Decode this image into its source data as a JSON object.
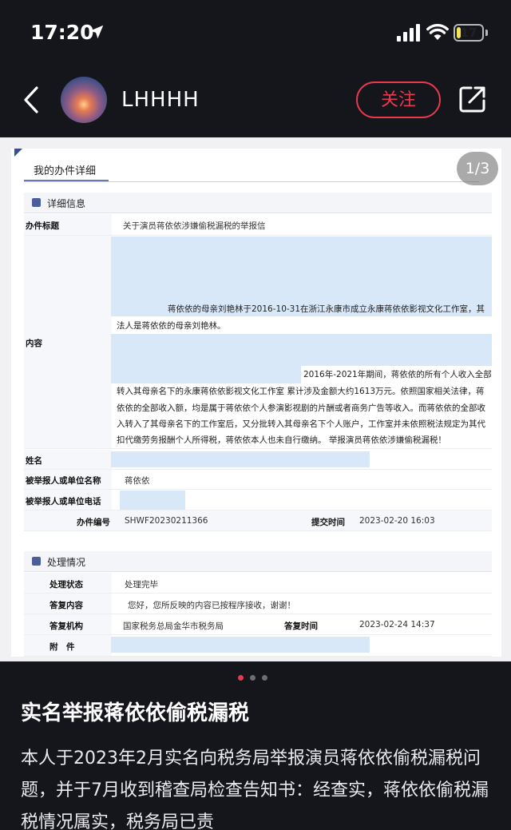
{
  "status_bar": {
    "time": "17:20",
    "battery": "17",
    "battery_level": 0.17
  },
  "nav": {
    "username": "LHHHH",
    "follow_label": "关注"
  },
  "pager": "1/3",
  "doc": {
    "title": "我的办件详细",
    "detail_section": "详细信息",
    "labels": {
      "subject": "办件标题",
      "content": "内容",
      "name": "姓名",
      "reported": "被举报人或单位名称",
      "reported_phone": "被举报人或单位电话",
      "number": "办件编号",
      "submit_time": "提交时间"
    },
    "subject": "关于演员蒋依依涉嫌偷税漏税的举报信",
    "content_p1_a": "蒋依依的母亲刘艳林于2016-10-31在浙江永康市成立永康蒋依依影视文化工作室，其",
    "content_p1_b": "法人是蒋依依的母亲刘艳林。",
    "content_p2_a": "2016年-2021年期间，蒋依依的所有个人收入全部",
    "content_p2_b": "转入其母亲名下的永康蒋依依影视文化工作室 累计涉及金额大约1613万元。依照国家相关法律，蒋",
    "content_p2_c": "依依的全部收入额，均是属于蒋依依个人参演影视剧的片酬或者商务广告等收入。而蒋依依的全部收",
    "content_p2_d": "入转入了其母亲名下的工作室后，又分批转入其母亲名下个人账户，工作室并未依照税法规定为其代",
    "content_p2_e": "扣代缴劳务报酬个人所得税，蒋依依本人也未自行缴纳。      举报演员蒋依依涉嫌偷税漏税！",
    "reported": "蒋依依",
    "number": "SHWF20230211366",
    "submit_time": "2023-02-20 16:03",
    "process_section": "处理情况",
    "process_labels": {
      "state": "处理状态",
      "reply": "答复内容",
      "org": "答复机构",
      "reply_time": "答复时间",
      "attach": "附　件"
    },
    "state": "处理完毕",
    "reply": "您好，您所反映的内容已按程序接收，谢谢！",
    "org": "国家税务总局金华市税务局",
    "reply_time": "2023-02-24 14:37"
  },
  "post": {
    "title": "实名举报蒋依依偷税漏税",
    "body": "本人于2023年2月实名向税务局举报演员蒋依依偷税漏税问题，并于7月收到稽查局检查告知书：经查实，蒋依依偷税漏税情况属实，税务局已责"
  },
  "colors": {
    "accent": "#e8394e",
    "highlight": "#d8e8f8",
    "active_dot": "#e8394e"
  },
  "icons": [
    "location-arrow-icon",
    "signal-icon",
    "wifi-icon",
    "battery-icon",
    "back-chevron-icon",
    "share-icon",
    "section-icon"
  ]
}
